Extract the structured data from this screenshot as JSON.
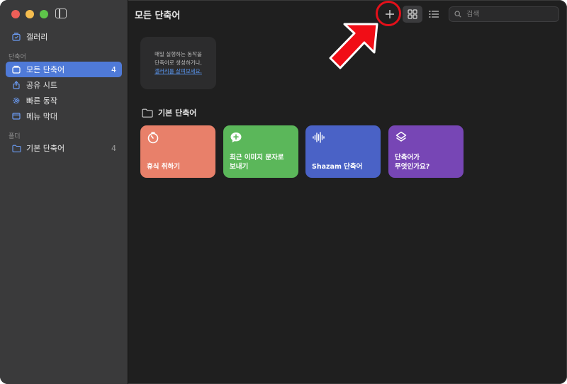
{
  "window": {
    "title": "모든 단축어"
  },
  "sidebar": {
    "top_items": [
      {
        "label": "갤러리",
        "icon": "gallery-icon"
      }
    ],
    "section_shortcuts": "단축어",
    "items": [
      {
        "label": "모든 단축어",
        "count": "4",
        "icon": "stack-icon",
        "active": true
      },
      {
        "label": "공유 시트",
        "icon": "share-icon"
      },
      {
        "label": "빠른 동작",
        "icon": "gear-icon"
      },
      {
        "label": "메뉴 막대",
        "icon": "menubar-icon"
      }
    ],
    "section_folders": "폴더",
    "folders": [
      {
        "label": "기본 단축어",
        "count": "4",
        "icon": "folder-icon"
      }
    ]
  },
  "toolbar": {
    "add_label": "+",
    "search_placeholder": "검색"
  },
  "gallery_card": {
    "line1": "매일 실행하는 동작을",
    "line2": "단축어로 생성하거나,",
    "link": "갤러리를 살펴보세요."
  },
  "folder": {
    "title": "기본 단축어",
    "cards": [
      {
        "label": "휴식 취하기",
        "color": "#e8806a",
        "icon": "timer-icon"
      },
      {
        "label": "최근 이미지 문자로\n보내기",
        "color": "#5bb75a",
        "icon": "message-plus-icon"
      },
      {
        "label": "Shazam 단축어",
        "color": "#4a62c6",
        "icon": "waveform-icon"
      },
      {
        "label": "단축어가\n무엇인가요?",
        "color": "#7746b5",
        "icon": "layers-icon"
      }
    ]
  },
  "colors": {
    "accent": "#4f7ad8",
    "highlight": "#e3101a"
  }
}
